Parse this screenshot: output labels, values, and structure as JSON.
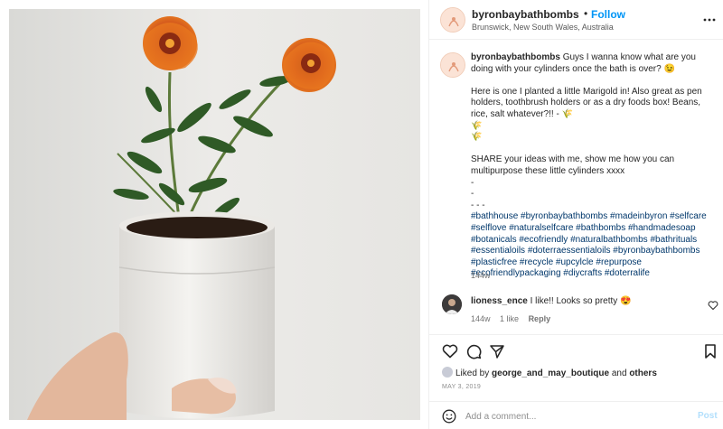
{
  "post": {
    "username": "byronbaybathbombs",
    "follow_label": "Follow",
    "separator": "•",
    "location": "Brunswick, New South Wales, Australia",
    "caption_intro": "Guys I wanna know what are you doing with your cylinders once the bath is over? 😉",
    "caption_body": "\nHere is one I planted a little Marigold in! Also great as pen holders, toothbrush holders or as a dry foods box! Beans, rice, salt whatever?!! - 🌾\n🌾\n🌾\n\nSHARE your ideas with me, show me how you can multipurpose these little cylinders xxxx\n-\n-\n- - -",
    "hashtags": "#bathhouse #byronbaybathbombs #madeinbyron #selfcare #selflove #naturalselfcare #bathbombs #handmadesoap #botanicals #ecofriendly #naturalbathbombs #bathrituals #essentialoils #doterraessentialoils #byronbaybathbombs #plasticfree #recycle #upcylcle #repurpose #ecofriendlypackaging #diycrafts #doterralife",
    "caption_time": "144w"
  },
  "comment": {
    "username": "lioness_ence",
    "text": "I like!! Looks so pretty 😍",
    "time": "144w",
    "likes": "1 like",
    "reply_label": "Reply"
  },
  "actions": {
    "liked_by_prefix": "Liked by",
    "liked_by_user": "george_and_may_boutique",
    "liked_by_and": "and",
    "liked_by_others": "others",
    "date": "MAY 3, 2019"
  },
  "add_comment": {
    "placeholder": "Add a comment...",
    "post_label": "Post"
  },
  "colors": {
    "accent": "#0095f6",
    "hashtag": "#00376b",
    "post_disabled": "#b2dffc",
    "border": "#efefef"
  },
  "icons": {
    "more": "ellipsis-icon",
    "like": "heart-icon",
    "comment": "comment-icon",
    "share": "paper-plane-icon",
    "save": "bookmark-icon",
    "emoji": "emoji-icon"
  }
}
